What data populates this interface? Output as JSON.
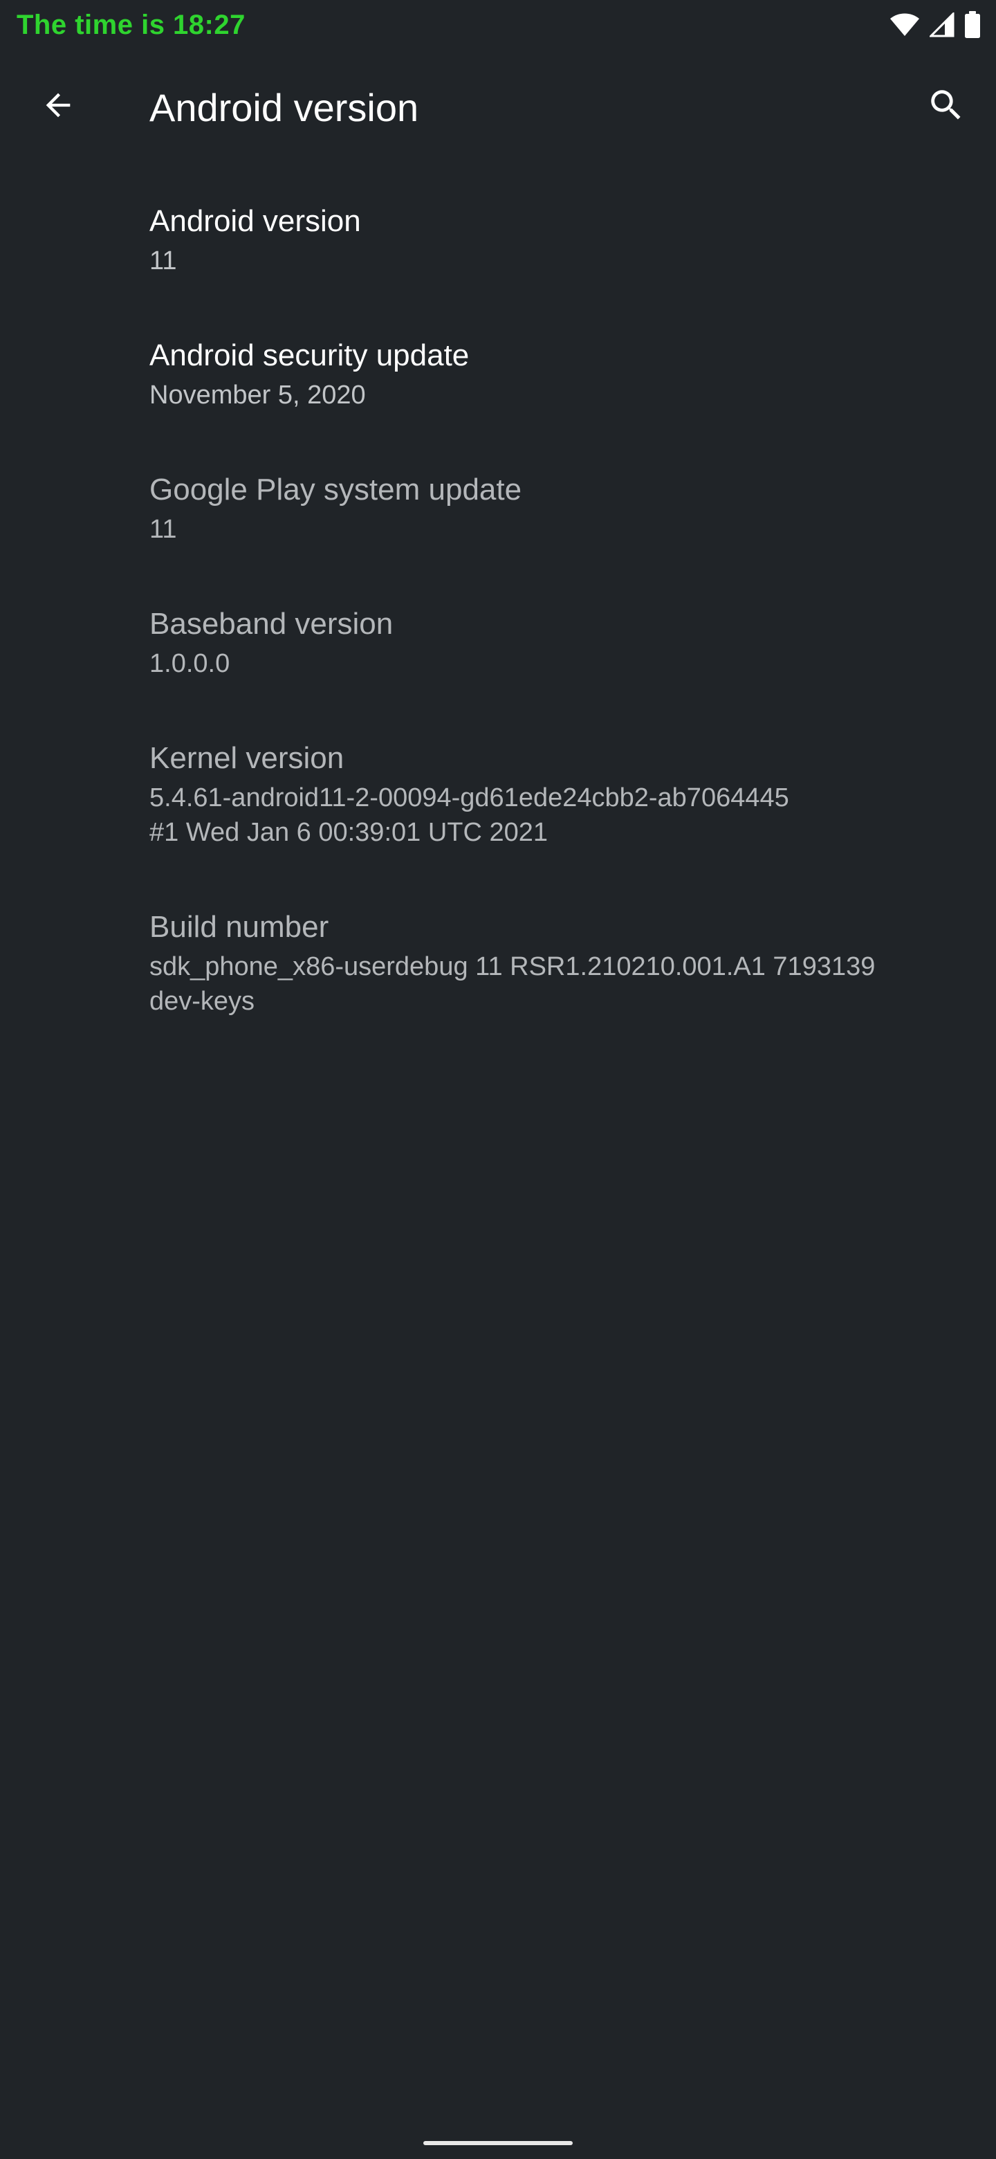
{
  "status_bar": {
    "time_text": "The time is 18:27",
    "icons": [
      "wifi-icon",
      "cellular-signal-icon",
      "battery-icon"
    ]
  },
  "app_bar": {
    "title": "Android version",
    "back_icon": "arrow-back-icon",
    "search_icon": "search-icon"
  },
  "items": [
    {
      "title": "Android version",
      "summary": "11",
      "enabled": true
    },
    {
      "title": "Android security update",
      "summary": "November 5, 2020",
      "enabled": true
    },
    {
      "title": "Google Play system update",
      "summary": "11",
      "enabled": false
    },
    {
      "title": "Baseband version",
      "summary": "1.0.0.0",
      "enabled": false
    },
    {
      "title": "Kernel version",
      "summary": "5.4.61-android11-2-00094-gd61ede24cbb2-ab7064445\n#1 Wed Jan 6 00:39:01 UTC 2021",
      "enabled": false
    },
    {
      "title": "Build number",
      "summary": "sdk_phone_x86-userdebug 11 RSR1.210210.001.A1 7193139\ndev-keys",
      "enabled": false
    }
  ],
  "colors": {
    "background": "#202428",
    "status_time": "#2fd42f",
    "title_enabled": "#ffffff",
    "text_dim": "#b4b7ba"
  }
}
